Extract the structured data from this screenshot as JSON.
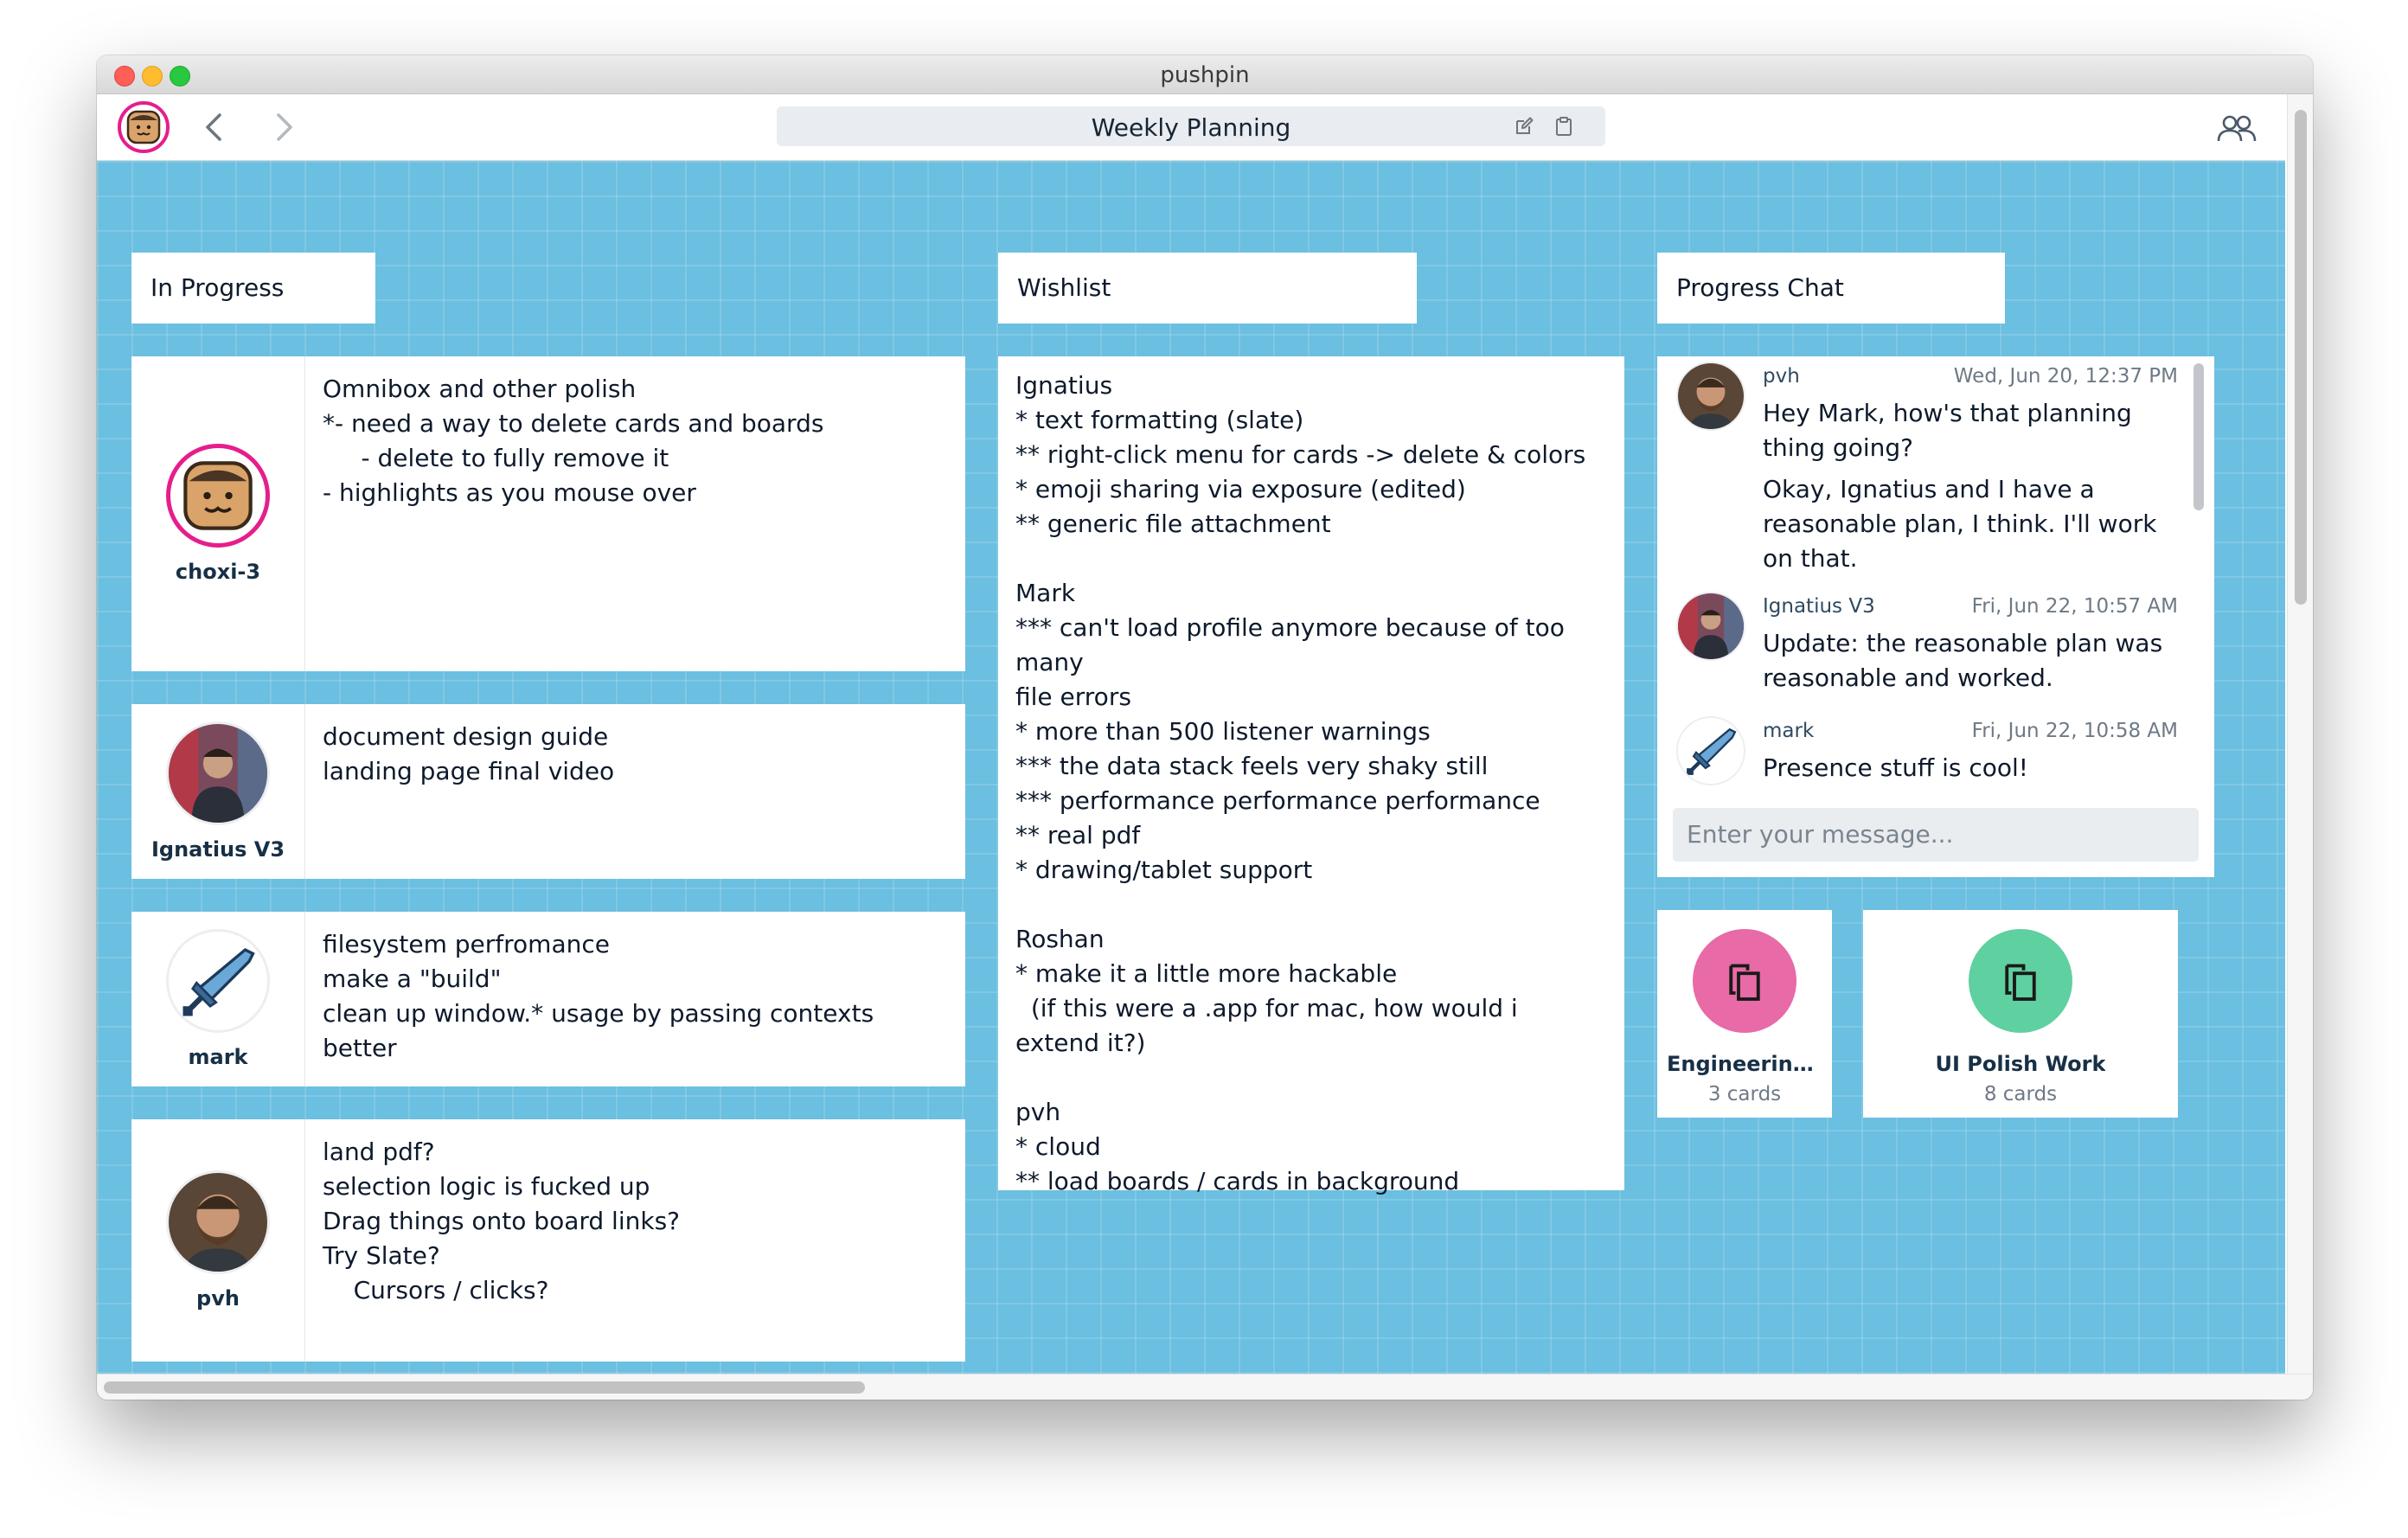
{
  "window": {
    "title": "pushpin"
  },
  "toolbar": {
    "board_title": "Weekly Planning",
    "back_icon": "chevron-left-icon",
    "forward_icon": "chevron-right-icon",
    "edit_icon": "edit-icon",
    "clipboard_icon": "clipboard-icon",
    "people_icon": "people-icon",
    "accent": "#e61e8c"
  },
  "board": {
    "background": "#6bbfe0",
    "column_labels": [
      "In Progress",
      "Wishlist",
      "Progress Chat"
    ],
    "contact_cards": [
      {
        "name": "choxi-3",
        "text": "Omnibox and other polish\n*- need a way to delete cards and boards\n     - delete to fully remove it\n- highlights as you mouse over"
      },
      {
        "name": "Ignatius V3",
        "text": "document design guide\nlanding page final video"
      },
      {
        "name": "mark",
        "text": "filesystem perfromance\nmake a \"build\"\nclean up window.* usage by passing contexts better"
      },
      {
        "name": "pvh",
        "text": "land pdf?\nselection logic is fucked up\nDrag things onto board links?\nTry Slate?\n    Cursors / clicks?"
      }
    ],
    "wishlist_text": "Ignatius\n* text formatting (slate)\n** right-click menu for cards -> delete & colors\n* emoji sharing via exposure (edited)\n** generic file attachment\n\nMark\n*** can't load profile anymore because of too many\nfile errors\n* more than 500 listener warnings\n*** the data stack feels very shaky still\n*** performance performance performance\n** real pdf\n* drawing/tablet support\n\nRoshan\n* make it a little more hackable\n  (if this were a .app for mac, how would i extend it?)\n\npvh\n* cloud\n** load boards / cards in background",
    "chat": {
      "messages": [
        {
          "author": "pvh",
          "time": "Wed, Jun 20, 12:37 PM",
          "lines": [
            "Hey Mark, how's that planning thing going?",
            "Okay, Ignatius and I have a reasonable plan, I think. I'll work on that."
          ]
        },
        {
          "author": "Ignatius V3",
          "time": "Fri, Jun 22, 10:57 AM",
          "lines": [
            "Update: the reasonable plan was reasonable and worked."
          ]
        },
        {
          "author": "mark",
          "time": "Fri, Jun 22, 10:58 AM",
          "lines": [
            "Presence stuff is cool!"
          ]
        }
      ],
      "input_placeholder": "Enter your message..."
    },
    "board_links": [
      {
        "title": "Engineering ...",
        "count": "3 cards",
        "color": "#e86aa6",
        "icon": "cards-icon"
      },
      {
        "title": "UI Polish Work",
        "count": "8 cards",
        "color": "#5fd0a0",
        "icon": "cards-icon"
      }
    ]
  }
}
